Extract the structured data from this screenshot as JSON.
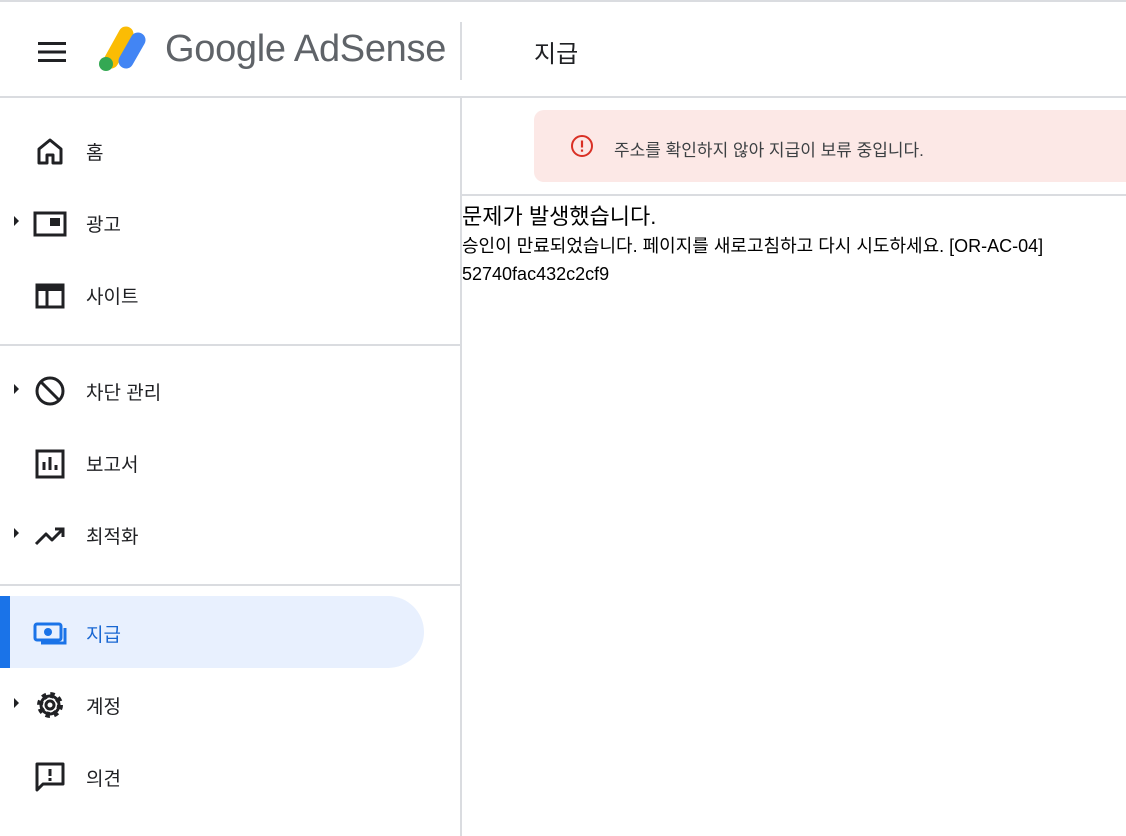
{
  "header": {
    "brand": "Google AdSense",
    "page_title": "지급"
  },
  "sidebar": {
    "items": [
      {
        "label": "홈",
        "icon": "home-icon"
      },
      {
        "label": "광고",
        "icon": "ads-icon",
        "expandable": true
      },
      {
        "label": "사이트",
        "icon": "sites-icon"
      },
      {
        "label": "차단 관리",
        "icon": "block-icon",
        "expandable": true
      },
      {
        "label": "보고서",
        "icon": "reports-icon"
      },
      {
        "label": "최적화",
        "icon": "trending-icon",
        "expandable": true
      },
      {
        "label": "지급",
        "icon": "payments-icon",
        "active": true
      },
      {
        "label": "계정",
        "icon": "gear-icon",
        "expandable": true
      },
      {
        "label": "의견",
        "icon": "feedback-icon"
      }
    ]
  },
  "alert": {
    "text": "주소를 확인하지 않아 지급이 보류 중입니다.",
    "icon": "error-icon"
  },
  "error": {
    "title": "문제가 발생했습니다.",
    "message": "승인이 만료되었습니다. 페이지를 새로고침하고 다시 시도하세요. [OR-AC-04]",
    "code": "52740fac432c2cf9"
  },
  "colors": {
    "accent": "#1a73e8",
    "active_bg": "#e8f0fe",
    "alert_bg": "#fce8e6",
    "alert_icon": "#d93025"
  }
}
